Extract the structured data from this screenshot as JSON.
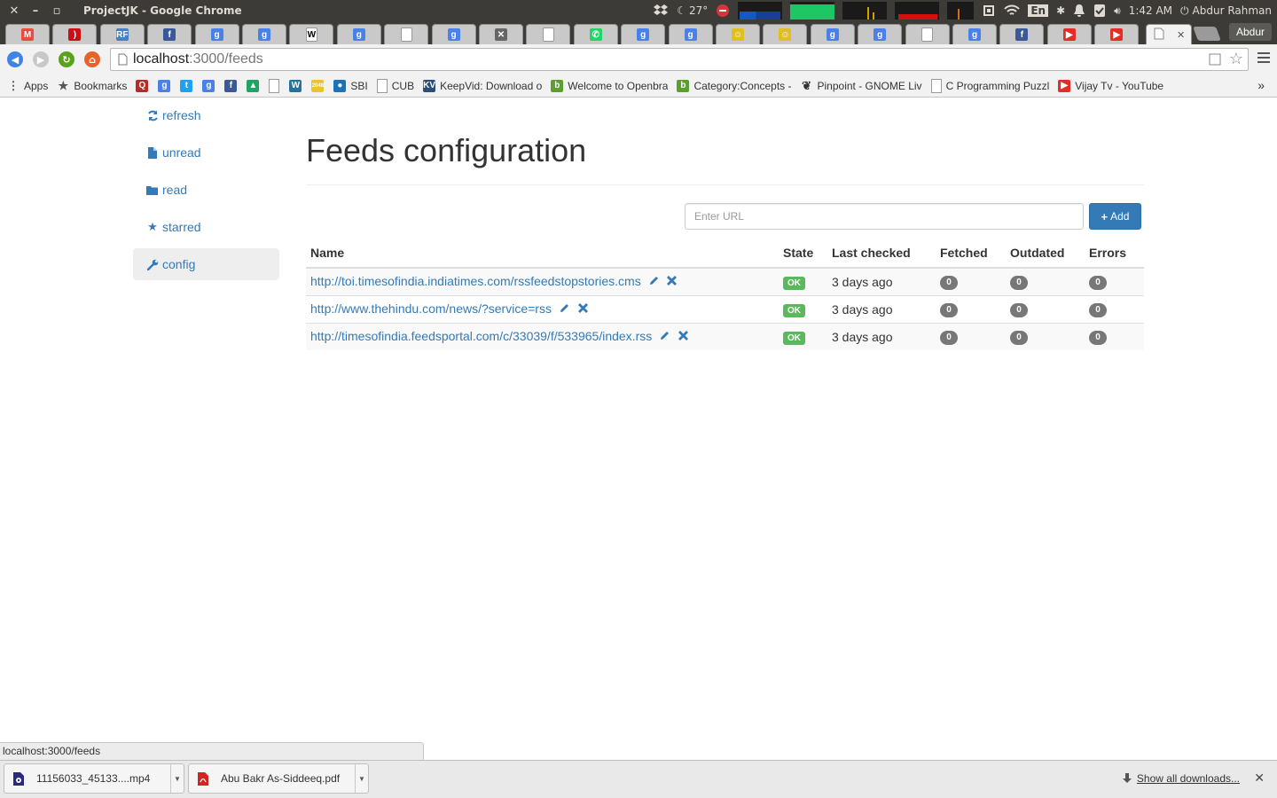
{
  "window": {
    "title": "ProjectJK - Google Chrome",
    "close": "✕",
    "minimize": "–",
    "maximize": "▫"
  },
  "panel": {
    "temperature": "27°",
    "keyboard": "En",
    "time": "1:42 AM",
    "user": "Abdur Rahman"
  },
  "tabs": [
    {
      "icon": "gmail-icon",
      "color": "#e74c3c",
      "glyph": "M"
    },
    {
      "icon": "opera-icon",
      "color": "#cc0f16",
      "glyph": ")"
    },
    {
      "icon": "rf-icon",
      "color": "#4a7fc1",
      "glyph": "RF"
    },
    {
      "icon": "facebook-icon",
      "color": "#3b5998",
      "glyph": "f"
    },
    {
      "icon": "google-icon",
      "color": "#4a80e8",
      "glyph": "g"
    },
    {
      "icon": "google-icon",
      "color": "#4a80e8",
      "glyph": "g"
    },
    {
      "icon": "wikipedia-icon",
      "color": "#ffffff",
      "glyph": "W"
    },
    {
      "icon": "google-icon",
      "color": "#4a80e8",
      "glyph": "g"
    },
    {
      "icon": "page-icon",
      "color": "#ffffff",
      "glyph": ""
    },
    {
      "icon": "google-icon",
      "color": "#4a80e8",
      "glyph": "g"
    },
    {
      "icon": "tools-icon",
      "color": "#666666",
      "glyph": "✕"
    },
    {
      "icon": "page-icon",
      "color": "#ffffff",
      "glyph": ""
    },
    {
      "icon": "whatsapp-icon",
      "color": "#25d366",
      "glyph": "✆"
    },
    {
      "icon": "google-icon",
      "color": "#4a80e8",
      "glyph": "g"
    },
    {
      "icon": "google-icon",
      "color": "#4a80e8",
      "glyph": "g"
    },
    {
      "icon": "troll-face-icon",
      "color": "#e0c020",
      "glyph": "☺"
    },
    {
      "icon": "troll-face-icon",
      "color": "#e0c020",
      "glyph": "☺"
    },
    {
      "icon": "google-icon",
      "color": "#4a80e8",
      "glyph": "g"
    },
    {
      "icon": "google-icon",
      "color": "#4a80e8",
      "glyph": "g"
    },
    {
      "icon": "page-icon",
      "color": "#ffffff",
      "glyph": ""
    },
    {
      "icon": "google-icon",
      "color": "#4a80e8",
      "glyph": "g"
    },
    {
      "icon": "facebook-icon",
      "color": "#3b5998",
      "glyph": "f"
    },
    {
      "icon": "youtube-icon",
      "color": "#e52d27",
      "glyph": "▶"
    },
    {
      "icon": "youtube-icon",
      "color": "#e52d27",
      "glyph": "▶"
    }
  ],
  "active_tab": {
    "icon": "page-icon",
    "close": "✕"
  },
  "profile_button": "Abdur",
  "address_bar": {
    "host": "localhost",
    "path": ":3000/feeds"
  },
  "bookmarks": [
    {
      "label": "Apps",
      "icon": "apps-icon",
      "color": "#555555",
      "glyph": "⋮"
    },
    {
      "label": "Bookmarks",
      "icon": "star-icon",
      "color": "#555555",
      "glyph": "★"
    },
    {
      "label": "",
      "icon": "quora-icon",
      "color": "#b92b27",
      "glyph": "Q"
    },
    {
      "label": "",
      "icon": "google-icon",
      "color": "#4a80e8",
      "glyph": "g"
    },
    {
      "label": "",
      "icon": "twitter-icon",
      "color": "#1da1f2",
      "glyph": "t"
    },
    {
      "label": "",
      "icon": "google-icon",
      "color": "#4a80e8",
      "glyph": "g"
    },
    {
      "label": "",
      "icon": "facebook-icon",
      "color": "#3b5998",
      "glyph": "f"
    },
    {
      "label": "",
      "icon": "drive-icon",
      "color": "#1fa463",
      "glyph": "▲"
    },
    {
      "label": "",
      "icon": "page-icon",
      "color": "#ffffff",
      "glyph": ""
    },
    {
      "label": "",
      "icon": "wordpress-icon",
      "color": "#21759b",
      "glyph": "W"
    },
    {
      "label": "",
      "icon": "2048-icon",
      "color": "#edc22e",
      "glyph": "2048"
    },
    {
      "label": "SBI",
      "icon": "sbi-icon",
      "color": "#1a73b8",
      "glyph": "●"
    },
    {
      "label": "CUB",
      "icon": "page-icon",
      "color": "#ffffff",
      "glyph": ""
    },
    {
      "label": "KeepVid: Download o",
      "icon": "keepvid-icon",
      "color": "#2a4d7a",
      "glyph": "KV"
    },
    {
      "label": "Welcome to Openbra",
      "icon": "openbravo-icon",
      "color": "#5aa02c",
      "glyph": "b"
    },
    {
      "label": "Category:Concepts - ",
      "icon": "openbravo-icon",
      "color": "#5aa02c",
      "glyph": "b"
    },
    {
      "label": "Pinpoint - GNOME Liv",
      "icon": "gnome-icon",
      "color": "#333333",
      "glyph": "❦"
    },
    {
      "label": "C Programming Puzzl",
      "icon": "page-icon",
      "color": "#ffffff",
      "glyph": ""
    },
    {
      "label": "Vijay Tv - YouTube",
      "icon": "youtube-icon",
      "color": "#e52d27",
      "glyph": "▶"
    }
  ],
  "bookmarks_overflow": "»",
  "sidebar": {
    "items": [
      {
        "label": "refresh",
        "icon": "refresh-icon"
      },
      {
        "label": "unread",
        "icon": "file-icon"
      },
      {
        "label": "read",
        "icon": "folder-open-icon"
      },
      {
        "label": "starred",
        "icon": "star-icon"
      },
      {
        "label": "config",
        "icon": "wrench-icon",
        "active": true
      }
    ]
  },
  "main": {
    "title": "Feeds configuration",
    "url_placeholder": "Enter URL",
    "add_label": "Add",
    "columns": [
      "Name",
      "State",
      "Last checked",
      "Fetched",
      "Outdated",
      "Errors"
    ],
    "feeds": [
      {
        "url": "http://toi.timesofindia.indiatimes.com/rssfeedstopstories.cms",
        "state": "OK",
        "last_checked": "3 days ago",
        "fetched": "0",
        "outdated": "0",
        "errors": "0"
      },
      {
        "url": "http://www.thehindu.com/news/?service=rss",
        "state": "OK",
        "last_checked": "3 days ago",
        "fetched": "0",
        "outdated": "0",
        "errors": "0"
      },
      {
        "url": "http://timesofindia.feedsportal.com/c/33039/f/533965/index.rss",
        "state": "OK",
        "last_checked": "3 days ago",
        "fetched": "0",
        "outdated": "0",
        "errors": "0"
      }
    ]
  },
  "status_url": "localhost:3000/feeds",
  "downloads": {
    "items": [
      {
        "name": "11156033_45133....mp4",
        "icon": "video-file-icon"
      },
      {
        "name": "Abu Bakr As-Siddeeq.pdf",
        "icon": "pdf-file-icon"
      }
    ],
    "show_all": "Show all downloads...",
    "close": "✕"
  },
  "colors": {
    "link": "#337ab7",
    "ok_label": "#5cb85c",
    "badge": "#777777",
    "add_button": "#337ab7"
  }
}
